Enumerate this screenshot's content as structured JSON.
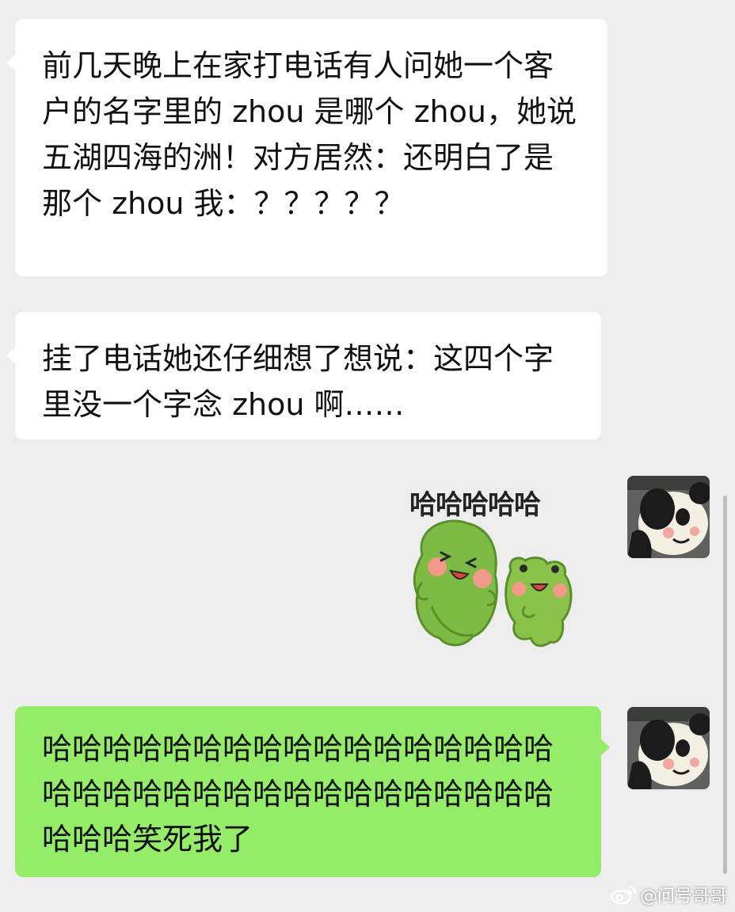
{
  "messages": [
    {
      "direction": "incoming",
      "text": "前几天晚上在家打电话有人问她一个客户的名字里的 zhou 是哪个 zhou，她说五湖四海的洲！对方居然：还明白了是那个 zhou  我：？？？？？"
    },
    {
      "direction": "incoming",
      "text": "挂了电话她还仔细想了想说：这四个字里没一个字念 zhou 啊……"
    },
    {
      "direction": "outgoing",
      "type": "sticker",
      "caption": "哈哈哈哈哈",
      "icon": "laughing-frogs-sticker"
    },
    {
      "direction": "outgoing",
      "text": "哈哈哈哈哈哈哈哈哈哈哈哈哈哈哈哈哈哈哈哈哈哈哈哈哈哈哈哈哈哈哈哈哈哈哈哈哈笑死我了"
    }
  ],
  "avatar_icon": "panda-avatar-icon",
  "watermark": {
    "icon": "weibo-icon",
    "text": "@问号哥哥"
  },
  "colors": {
    "background": "#ededed",
    "incoming_bubble": "#ffffff",
    "outgoing_bubble": "#95ec69"
  }
}
